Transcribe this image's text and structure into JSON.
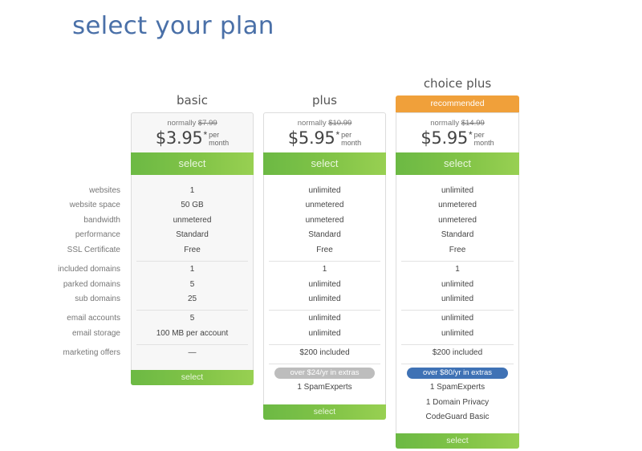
{
  "page": {
    "title": "select your plan"
  },
  "feature_labels": [
    "websites",
    "website space",
    "bandwidth",
    "performance",
    "SSL Certificate",
    "included domains",
    "parked domains",
    "sub domains",
    "email accounts",
    "email storage",
    "marketing offers"
  ],
  "plans": [
    {
      "name": "basic",
      "recommended": null,
      "normally_label": "normally",
      "normal_price": "$7.99",
      "price": "$3.95",
      "asterisk": "*",
      "per_label": "per",
      "period_label": "month",
      "select_label": "select",
      "features": [
        "1",
        "50 GB",
        "unmetered",
        "Standard",
        "Free",
        "1",
        "5",
        "25",
        "5",
        "100 MB per account",
        "—"
      ],
      "extras_badge": null,
      "extras": [],
      "bottom_select_label": "select"
    },
    {
      "name": "plus",
      "recommended": null,
      "normally_label": "normally",
      "normal_price": "$10.99",
      "price": "$5.95",
      "asterisk": "*",
      "per_label": "per",
      "period_label": "month",
      "select_label": "select",
      "features": [
        "unlimited",
        "unmetered",
        "unmetered",
        "Standard",
        "Free",
        "1",
        "unlimited",
        "unlimited",
        "unlimited",
        "unlimited",
        "$200 included"
      ],
      "extras_badge": "over $24/yr in extras",
      "extras": [
        "1 SpamExperts"
      ],
      "bottom_select_label": "select"
    },
    {
      "name": "choice plus",
      "recommended": "recommended",
      "normally_label": "normally",
      "normal_price": "$14.99",
      "price": "$5.95",
      "asterisk": "*",
      "per_label": "per",
      "period_label": "month",
      "select_label": "select",
      "features": [
        "unlimited",
        "unmetered",
        "unmetered",
        "Standard",
        "Free",
        "1",
        "unlimited",
        "unlimited",
        "unlimited",
        "unlimited",
        "$200 included"
      ],
      "extras_badge": "over $80/yr in extras",
      "extras": [
        "1 SpamExperts",
        "1 Domain Privacy",
        "CodeGuard Basic"
      ],
      "bottom_select_label": "select"
    }
  ],
  "colors": {
    "title": "#4a70a8",
    "select_green": "#7ac147",
    "recommended_orange": "#f0a03a",
    "badge_gray": "#bdbdbd",
    "badge_blue": "#3f72b5"
  }
}
